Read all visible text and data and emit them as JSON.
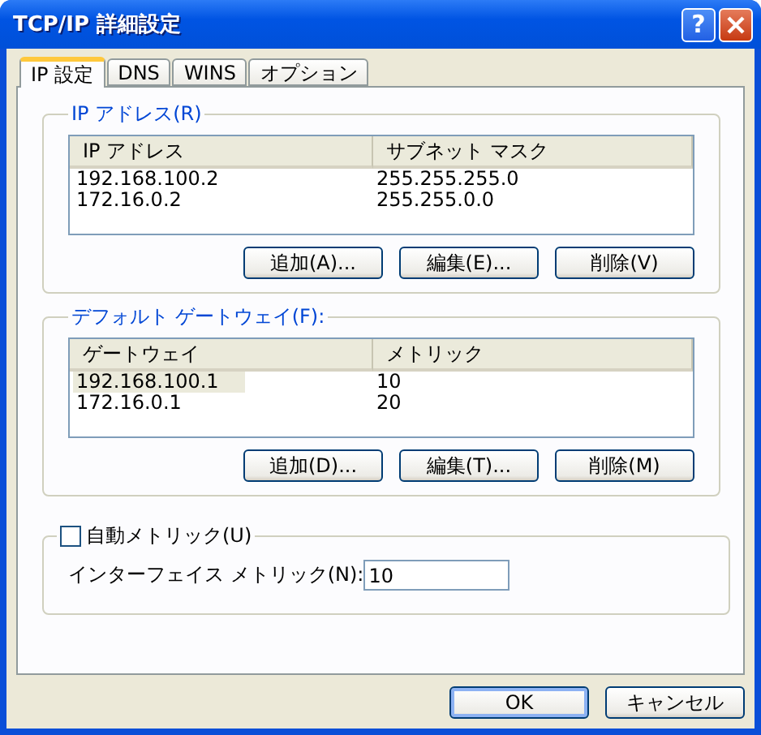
{
  "window": {
    "title": "TCP/IP 詳細設定",
    "help_button": "?"
  },
  "tabs": [
    {
      "label": "IP 設定",
      "selected": true
    },
    {
      "label": "DNS",
      "selected": false
    },
    {
      "label": "WINS",
      "selected": false
    },
    {
      "label": "オプション",
      "selected": false
    }
  ],
  "ip_addresses": {
    "label": "IP アドレス(R)",
    "columns": [
      "IP アドレス",
      "サブネット マスク"
    ],
    "rows": [
      {
        "cells": [
          "192.168.100.2",
          "255.255.255.0"
        ],
        "selected": false
      },
      {
        "cells": [
          "172.16.0.2",
          "255.255.0.0"
        ],
        "selected": false
      }
    ],
    "buttons": [
      "追加(A)...",
      "編集(E)...",
      "削除(V)"
    ]
  },
  "gateways": {
    "label": "デフォルト ゲートウェイ(F):",
    "columns": [
      "ゲートウェイ",
      "メトリック"
    ],
    "rows": [
      {
        "cells": [
          "192.168.100.1",
          "10"
        ],
        "selected": true
      },
      {
        "cells": [
          "172.16.0.1",
          "20"
        ],
        "selected": false
      }
    ],
    "buttons": [
      "追加(D)...",
      "編集(T)...",
      "削除(M)"
    ]
  },
  "auto_metric": {
    "label": "自動メトリック(U)",
    "checked": false
  },
  "interface_metric": {
    "label": "インターフェイス メトリック(N):",
    "value": "10"
  },
  "footer_buttons": [
    {
      "label": "OK",
      "default": true
    },
    {
      "label": "キャンセル",
      "default": false
    }
  ]
}
